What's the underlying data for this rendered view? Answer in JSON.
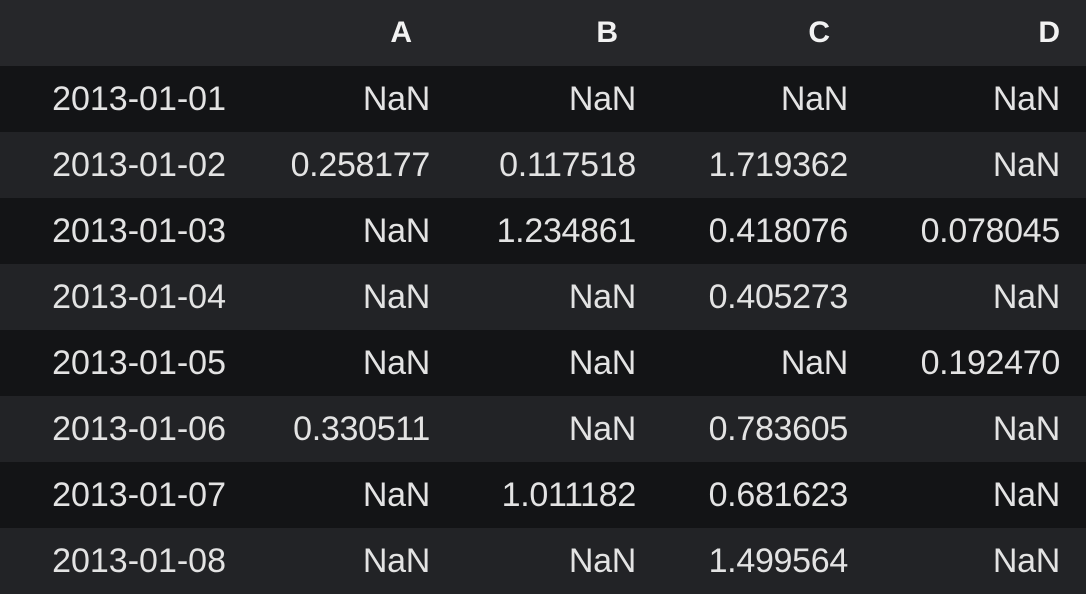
{
  "table": {
    "columns": [
      "A",
      "B",
      "C",
      "D"
    ],
    "rows": [
      {
        "index": "2013-01-01",
        "values": [
          "NaN",
          "NaN",
          "NaN",
          "NaN"
        ]
      },
      {
        "index": "2013-01-02",
        "values": [
          "0.258177",
          "0.117518",
          "1.719362",
          "NaN"
        ]
      },
      {
        "index": "2013-01-03",
        "values": [
          "NaN",
          "1.234861",
          "0.418076",
          "0.078045"
        ]
      },
      {
        "index": "2013-01-04",
        "values": [
          "NaN",
          "NaN",
          "0.405273",
          "NaN"
        ]
      },
      {
        "index": "2013-01-05",
        "values": [
          "NaN",
          "NaN",
          "NaN",
          "0.192470"
        ]
      },
      {
        "index": "2013-01-06",
        "values": [
          "0.330511",
          "NaN",
          "0.783605",
          "NaN"
        ]
      },
      {
        "index": "2013-01-07",
        "values": [
          "NaN",
          "1.011182",
          "0.681623",
          "NaN"
        ]
      },
      {
        "index": "2013-01-08",
        "values": [
          "NaN",
          "NaN",
          "1.499564",
          "NaN"
        ]
      }
    ]
  },
  "colors": {
    "background": "#1b1c1e",
    "header_row": "#26272a",
    "row_dark": "#131416",
    "row_light": "#222326",
    "text": "#e3e3e3"
  }
}
